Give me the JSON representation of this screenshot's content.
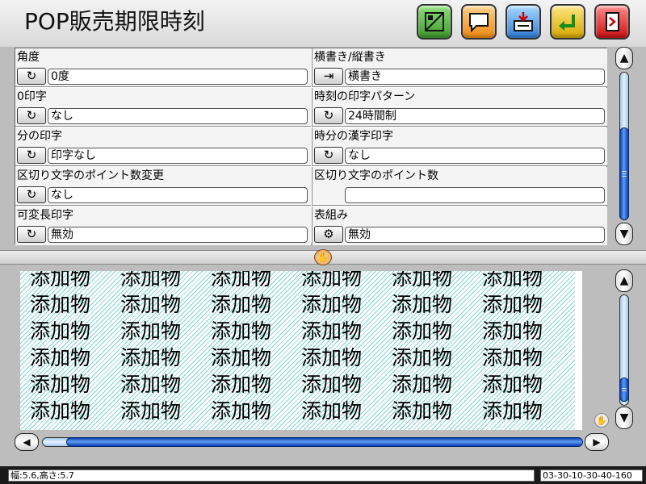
{
  "header": {
    "title": "POP販売期限時刻",
    "buttons": [
      {
        "name": "format-settings-icon"
      },
      {
        "name": "comment-icon"
      },
      {
        "name": "print-download-icon"
      },
      {
        "name": "back-arrow-icon"
      },
      {
        "name": "exit-door-icon"
      }
    ]
  },
  "settings": {
    "items": [
      {
        "label": "角度",
        "value": "0度",
        "icon": "cycle-icon"
      },
      {
        "label": "横書き/縦書き",
        "value": "横書き",
        "icon": "enter-arrow-icon"
      },
      {
        "label": "0印字",
        "value": "なし",
        "icon": "cycle-icon"
      },
      {
        "label": "時刻の印字パターン",
        "value": "24時間制",
        "icon": "cycle-icon"
      },
      {
        "label": "分の印字",
        "value": "印字なし",
        "icon": "cycle-icon"
      },
      {
        "label": "時分の漢字印字",
        "value": "なし",
        "icon": "cycle-icon"
      },
      {
        "label": "区切り文字のポイント数変更",
        "value": "なし",
        "icon": "cycle-icon"
      },
      {
        "label": "区切り文字のポイント数",
        "value": "",
        "icon": ""
      },
      {
        "label": "可変長印字",
        "value": "無効",
        "icon": "cycle-icon"
      },
      {
        "label": "表組み",
        "value": "無効",
        "icon": "table-settings-icon"
      }
    ]
  },
  "preview": {
    "word": "添加物",
    "rows": [
      [
        "添加物",
        "添加物",
        "添加物",
        "添加物",
        "添加物",
        "添加物"
      ],
      [
        "添加物",
        "添加物",
        "添加物",
        "添加物",
        "添加物",
        "添加物"
      ],
      [
        "添加物",
        "添加物",
        "添加物",
        "添加物",
        "添加物",
        "添加物"
      ],
      [
        "添加物",
        "添加物",
        "添加物",
        "添加物",
        "添加物",
        "添加物"
      ],
      [
        "添加物",
        "添加物",
        "添加物",
        "添加物",
        "添加物",
        "添加物"
      ],
      [
        "添加物",
        "添加物",
        "添加物",
        "添加物",
        "添加物",
        "添加物"
      ]
    ]
  },
  "status": {
    "left": "幅:5.6,高さ:5.7",
    "right": "03-30-10-30-40-160"
  },
  "glyphs": {
    "cycle": "↻",
    "enter": "⇥",
    "table": "⚙",
    "up": "▲",
    "down": "▼",
    "left": "◀",
    "right": "▶",
    "hand": "✋"
  }
}
